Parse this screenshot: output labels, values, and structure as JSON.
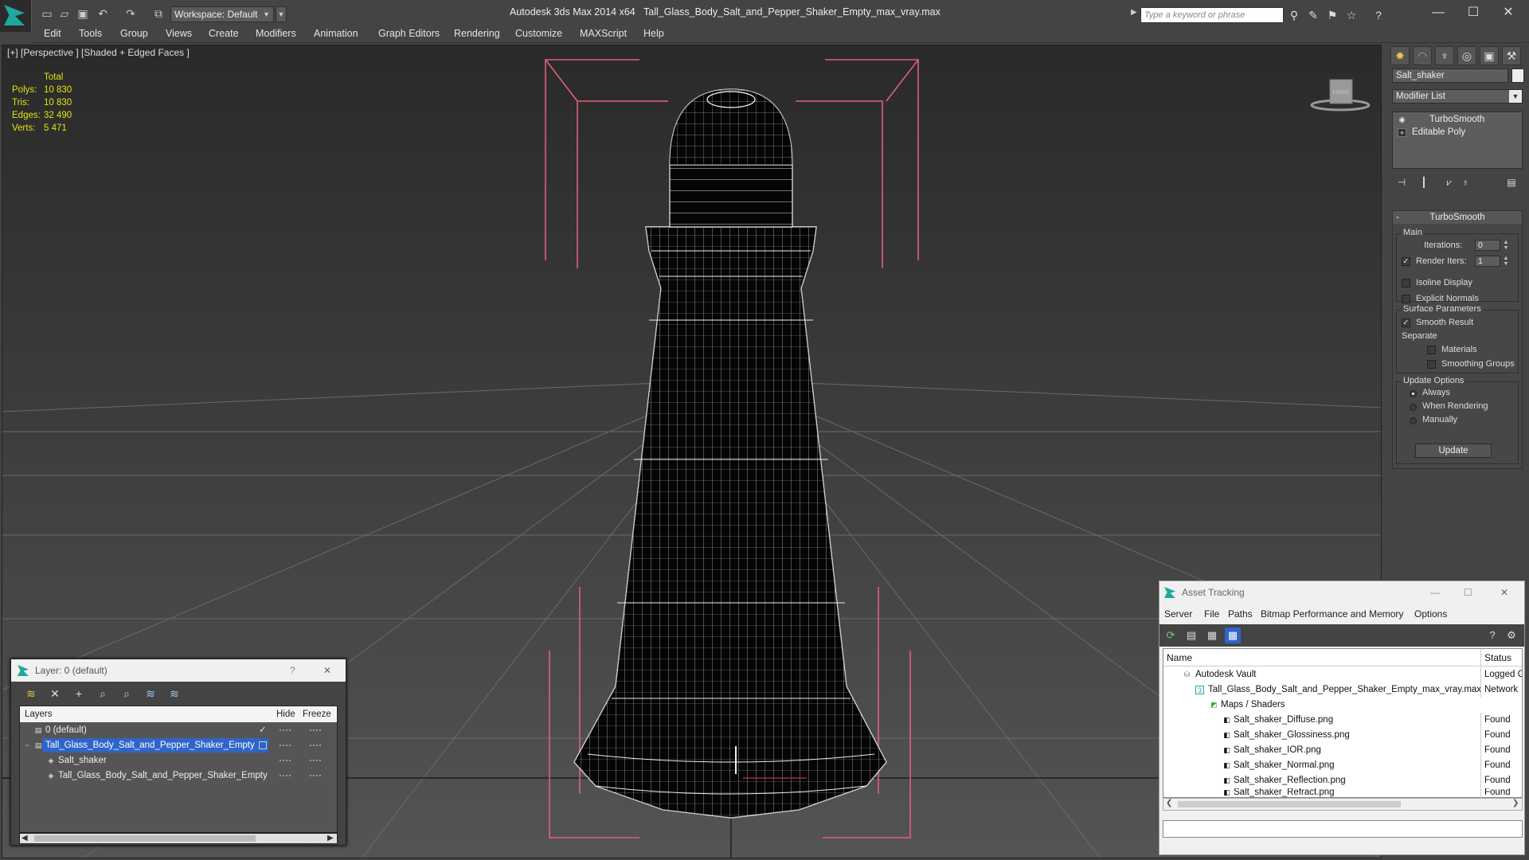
{
  "titlebar": {
    "app_title": "Autodesk 3ds Max  2014 x64",
    "document": "Tall_Glass_Body_Salt_and_Pepper_Shaker_Empty_max_vray.max",
    "workspace": "Workspace: Default",
    "search_placeholder": "Type a keyword or phrase"
  },
  "menu": [
    "Edit",
    "Tools",
    "Group",
    "Views",
    "Create",
    "Modifiers",
    "Animation",
    "Graph Editors",
    "Rendering",
    "Customize",
    "MAXScript",
    "Help"
  ],
  "viewport": {
    "label": "[+] [Perspective ] [Shaded + Edged Faces ]",
    "stats": {
      "header": "Total",
      "rows": [
        {
          "k": "Polys:",
          "v": "10 830"
        },
        {
          "k": "Tris:",
          "v": "10 830"
        },
        {
          "k": "Edges:",
          "v": "32 490"
        },
        {
          "k": "Verts:",
          "v": "5 471"
        }
      ]
    },
    "viewcube_label": "FRONT"
  },
  "command_panel": {
    "object_name": "Salt_shaker",
    "modifier_list": "Modifier List",
    "stack": [
      "TurboSmooth",
      "Editable Poly"
    ],
    "rollout_title": "TurboSmooth",
    "main_group": "Main",
    "iterations_label": "Iterations:",
    "iterations_value": "0",
    "render_iters_label": "Render Iters:",
    "render_iters_value": "1",
    "isoline": "Isoline Display",
    "explicit_normals": "Explicit Normals",
    "surface_group": "Surface Parameters",
    "smooth_result": "Smooth Result",
    "separate": "Separate",
    "materials": "Materials",
    "smoothing_groups": "Smoothing Groups",
    "update_group": "Update Options",
    "always": "Always",
    "when_rendering": "When Rendering",
    "manually": "Manually",
    "update_button": "Update"
  },
  "layer_dialog": {
    "title": "Layer: 0 (default)",
    "help": "?",
    "close": "✕",
    "col_layers": "Layers",
    "col_hide": "Hide",
    "col_freeze": "Freeze",
    "rows": [
      {
        "name": "0 (default)",
        "indent": 0
      },
      {
        "name": "Tall_Glass_Body_Salt_and_Pepper_Shaker_Empty",
        "indent": 0
      },
      {
        "name": "Salt_shaker",
        "indent": 1
      },
      {
        "name": "Tall_Glass_Body_Salt_and_Pepper_Shaker_Empty",
        "indent": 1
      }
    ]
  },
  "asset_dialog": {
    "title": "Asset Tracking",
    "menus": [
      "Server",
      "File",
      "Paths",
      "Bitmap Performance and Memory",
      "Options"
    ],
    "col_name": "Name",
    "col_status": "Status",
    "rows": [
      {
        "name": "Autodesk Vault",
        "status": "Logged C",
        "indent": 0
      },
      {
        "name": "Tall_Glass_Body_Salt_and_Pepper_Shaker_Empty_max_vray.max",
        "status": "Network",
        "indent": 1
      },
      {
        "name": "Maps / Shaders",
        "status": "",
        "indent": 2
      },
      {
        "name": "Salt_shaker_Diffuse.png",
        "status": "Found",
        "indent": 3
      },
      {
        "name": "Salt_shaker_Glossiness.png",
        "status": "Found",
        "indent": 3
      },
      {
        "name": "Salt_shaker_IOR.png",
        "status": "Found",
        "indent": 3
      },
      {
        "name": "Salt_shaker_Normal.png",
        "status": "Found",
        "indent": 3
      },
      {
        "name": "Salt_shaker_Reflection.png",
        "status": "Found",
        "indent": 3
      },
      {
        "name": "Salt_shaker_Refract.png",
        "status": "Found",
        "indent": 3
      }
    ]
  },
  "colors": {
    "accent": "#1fa7a0",
    "selection": "#2f64c8",
    "stats": "#e3e310",
    "bracket": "#e0607a"
  }
}
